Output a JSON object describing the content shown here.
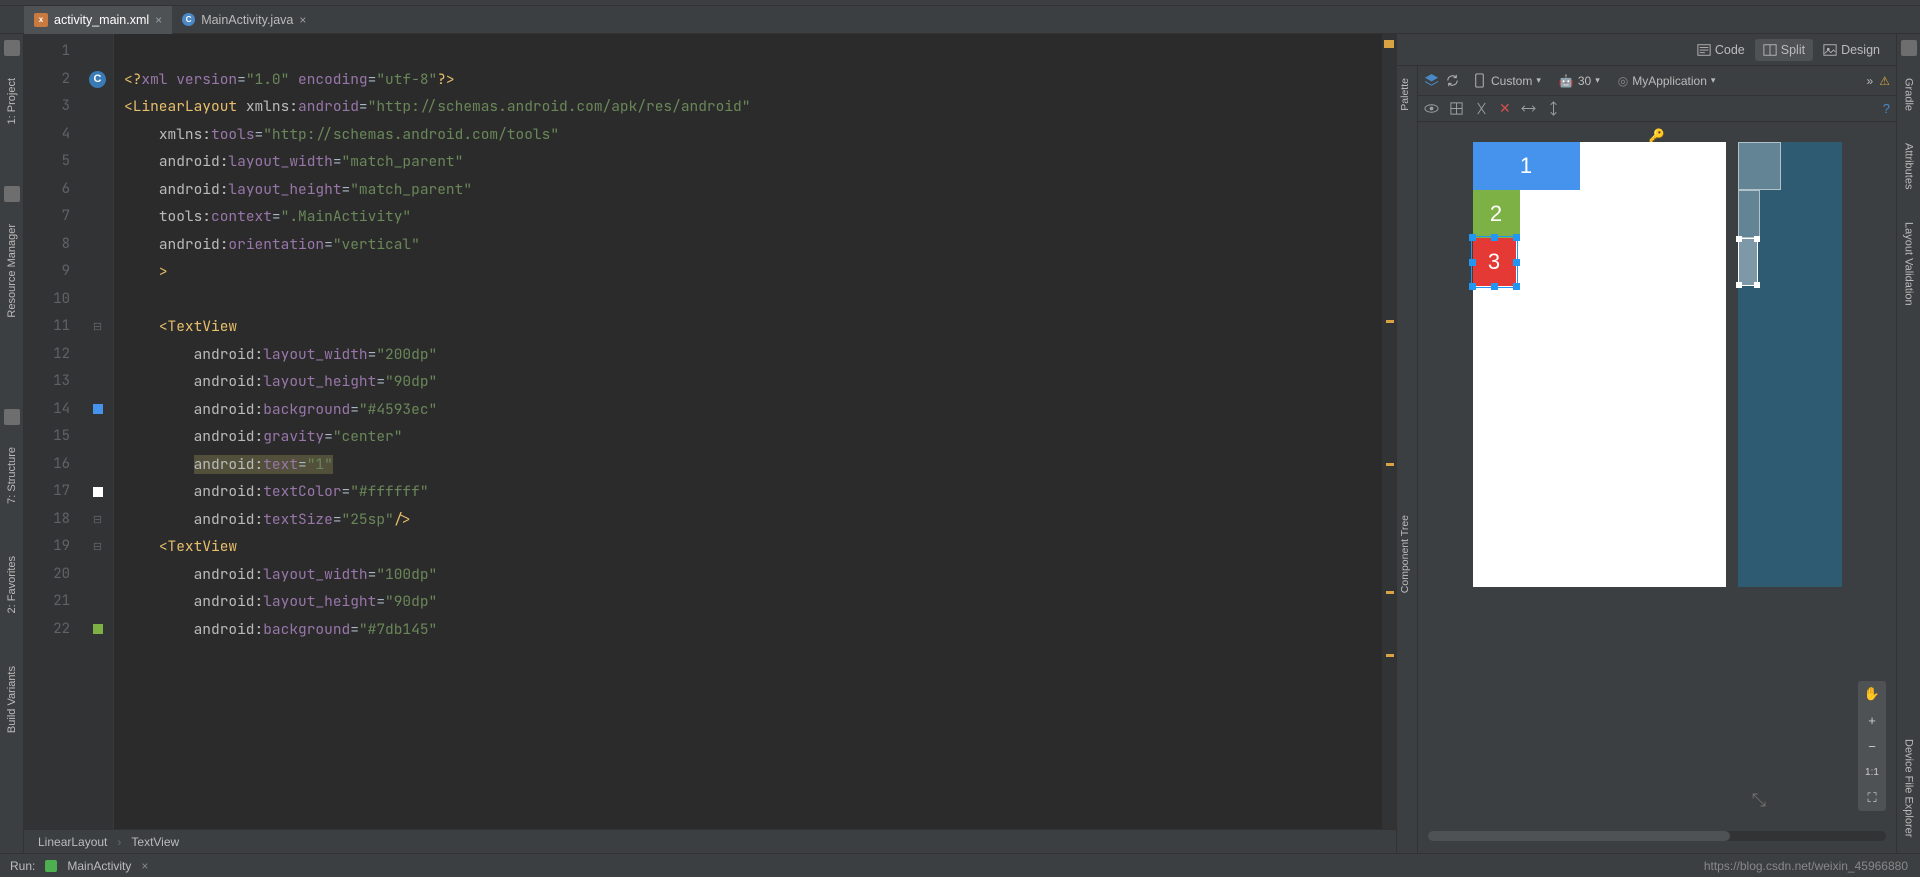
{
  "tabs": [
    {
      "name": "activity_main.xml",
      "active": true,
      "type": "xml"
    },
    {
      "name": "MainActivity.java",
      "active": false,
      "type": "java"
    }
  ],
  "leftTools": {
    "project": "1: Project",
    "resmgr": "Resource Manager",
    "structure": "7: Structure",
    "favorites": "2: Favorites",
    "variants": "Build Variants"
  },
  "rightTools": {
    "gradle": "Gradle",
    "attributes": "Attributes",
    "layoutVal": "Layout Validation",
    "devexp": "Device File Explorer"
  },
  "viewModes": {
    "code": "Code",
    "split": "Split",
    "design": "Design"
  },
  "designToolbar": {
    "custom": "Custom",
    "api": "30",
    "app": "MyApplication"
  },
  "paletteLabel": "Palette",
  "componentTreeLabel": "Component Tree",
  "lineCount": 22,
  "code": {
    "l1": {
      "a": "<?",
      "b": "xml version",
      "c": "=",
      "d": "\"1.0\"",
      "e": " encoding",
      "f": "=",
      "g": "\"utf-8\"",
      "h": "?>"
    },
    "l2": {
      "a": "<",
      "b": "LinearLayout ",
      "ns": "xmlns:",
      "c": "android",
      "d": "=",
      "e": "\"http://schemas.android.com/apk/res/android\""
    },
    "l3": {
      "ns": "xmlns:",
      "a": "tools",
      "b": "=",
      "c": "\"http://schemas.android.com/tools\""
    },
    "l4": {
      "ns": "android:",
      "a": "layout_width",
      "b": "=",
      "c": "\"match_parent\""
    },
    "l5": {
      "ns": "android:",
      "a": "layout_height",
      "b": "=",
      "c": "\"match_parent\""
    },
    "l6": {
      "ns": "tools:",
      "a": "context",
      "b": "=",
      "c": "\".MainActivity\""
    },
    "l7": {
      "ns": "android:",
      "a": "orientation",
      "b": "=",
      "c": "\"vertical\""
    },
    "l8": {
      "a": ">"
    },
    "l10": {
      "a": "<",
      "b": "TextView"
    },
    "l11": {
      "ns": "android:",
      "a": "layout_width",
      "b": "=",
      "c": "\"200dp\""
    },
    "l12": {
      "ns": "android:",
      "a": "layout_height",
      "b": "=",
      "c": "\"90dp\""
    },
    "l13": {
      "ns": "android:",
      "a": "background",
      "b": "=",
      "c": "\"#4593ec\""
    },
    "l14": {
      "ns": "android:",
      "a": "gravity",
      "b": "=",
      "c": "\"center\""
    },
    "l15": {
      "ns": "android:",
      "a": "text",
      "b": "=",
      "c": "\"1\""
    },
    "l16": {
      "ns": "android:",
      "a": "textColor",
      "b": "=",
      "c": "\"#ffffff\""
    },
    "l17": {
      "ns": "android:",
      "a": "textSize",
      "b": "=",
      "c": "\"25sp\"",
      "d": "/>"
    },
    "l18": {
      "a": "<",
      "b": "TextView"
    },
    "l19": {
      "ns": "android:",
      "a": "layout_width",
      "b": "=",
      "c": "\"100dp\""
    },
    "l20": {
      "ns": "android:",
      "a": "layout_height",
      "b": "=",
      "c": "\"90dp\""
    },
    "l21": {
      "ns": "android:",
      "a": "background",
      "b": "=",
      "c": "\"#7db145\""
    }
  },
  "preview": {
    "b1": "1",
    "b2": "2",
    "b3": "3"
  },
  "breadcrumb": {
    "a": "LinearLayout",
    "b": "TextView"
  },
  "run": {
    "label": "Run:",
    "config": "MainActivity"
  },
  "zoom": {
    "fit": "1:1"
  },
  "markC": "C",
  "watermark": "https://blog.csdn.net/weixin_45966880"
}
